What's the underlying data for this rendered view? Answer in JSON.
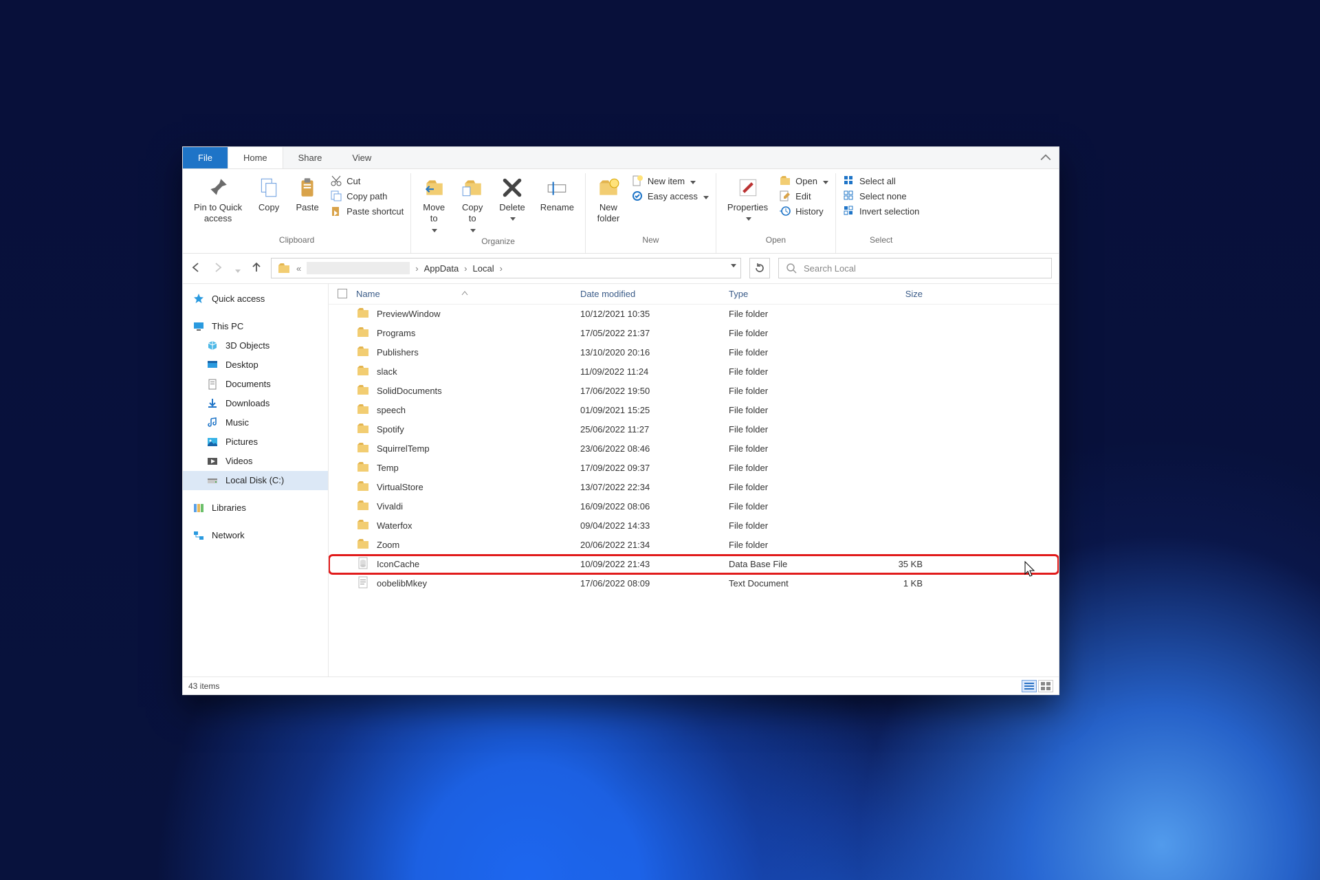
{
  "tabs": {
    "file": "File",
    "home": "Home",
    "share": "Share",
    "view": "View"
  },
  "ribbon": {
    "clipboard": {
      "label": "Clipboard",
      "pin": "Pin to Quick\naccess",
      "copy": "Copy",
      "paste": "Paste",
      "cut": "Cut",
      "copypath": "Copy path",
      "pasteshortcut": "Paste shortcut"
    },
    "organize": {
      "label": "Organize",
      "moveto": "Move\nto",
      "copyto": "Copy\nto",
      "delete": "Delete",
      "rename": "Rename"
    },
    "new": {
      "label": "New",
      "newfolder": "New\nfolder",
      "newitem": "New item",
      "easyaccess": "Easy access"
    },
    "open": {
      "label": "Open",
      "properties": "Properties",
      "open": "Open",
      "edit": "Edit",
      "history": "History"
    },
    "select": {
      "label": "Select",
      "all": "Select all",
      "none": "Select none",
      "invert": "Invert selection"
    }
  },
  "address": {
    "crumbs": [
      "AppData",
      "Local"
    ],
    "search_placeholder": "Search Local"
  },
  "sidebar": {
    "quick": "Quick access",
    "thispc": "This PC",
    "objects3d": "3D Objects",
    "desktop": "Desktop",
    "documents": "Documents",
    "downloads": "Downloads",
    "music": "Music",
    "pictures": "Pictures",
    "videos": "Videos",
    "localdisk": "Local Disk (C:)",
    "libraries": "Libraries",
    "network": "Network"
  },
  "columns": {
    "name": "Name",
    "date": "Date modified",
    "type": "Type",
    "size": "Size"
  },
  "rows": [
    {
      "icon": "folder",
      "name": "PreviewWindow",
      "date": "10/12/2021 10:35",
      "type": "File folder",
      "size": ""
    },
    {
      "icon": "folder",
      "name": "Programs",
      "date": "17/05/2022 21:37",
      "type": "File folder",
      "size": ""
    },
    {
      "icon": "folder",
      "name": "Publishers",
      "date": "13/10/2020 20:16",
      "type": "File folder",
      "size": ""
    },
    {
      "icon": "folder",
      "name": "slack",
      "date": "11/09/2022 11:24",
      "type": "File folder",
      "size": ""
    },
    {
      "icon": "folder",
      "name": "SolidDocuments",
      "date": "17/06/2022 19:50",
      "type": "File folder",
      "size": ""
    },
    {
      "icon": "folder",
      "name": "speech",
      "date": "01/09/2021 15:25",
      "type": "File folder",
      "size": ""
    },
    {
      "icon": "folder",
      "name": "Spotify",
      "date": "25/06/2022 11:27",
      "type": "File folder",
      "size": ""
    },
    {
      "icon": "folder",
      "name": "SquirrelTemp",
      "date": "23/06/2022 08:46",
      "type": "File folder",
      "size": ""
    },
    {
      "icon": "folder",
      "name": "Temp",
      "date": "17/09/2022 09:37",
      "type": "File folder",
      "size": ""
    },
    {
      "icon": "folder",
      "name": "VirtualStore",
      "date": "13/07/2022 22:34",
      "type": "File folder",
      "size": ""
    },
    {
      "icon": "folder",
      "name": "Vivaldi",
      "date": "16/09/2022 08:06",
      "type": "File folder",
      "size": ""
    },
    {
      "icon": "folder",
      "name": "Waterfox",
      "date": "09/04/2022 14:33",
      "type": "File folder",
      "size": ""
    },
    {
      "icon": "folder",
      "name": "Zoom",
      "date": "20/06/2022 21:34",
      "type": "File folder",
      "size": ""
    },
    {
      "icon": "db",
      "name": "IconCache",
      "date": "10/09/2022 21:43",
      "type": "Data Base File",
      "size": "35 KB",
      "highlight": true
    },
    {
      "icon": "txt",
      "name": "oobelibMkey",
      "date": "17/06/2022 08:09",
      "type": "Text Document",
      "size": "1 KB"
    }
  ],
  "status": {
    "count": "43 items"
  }
}
